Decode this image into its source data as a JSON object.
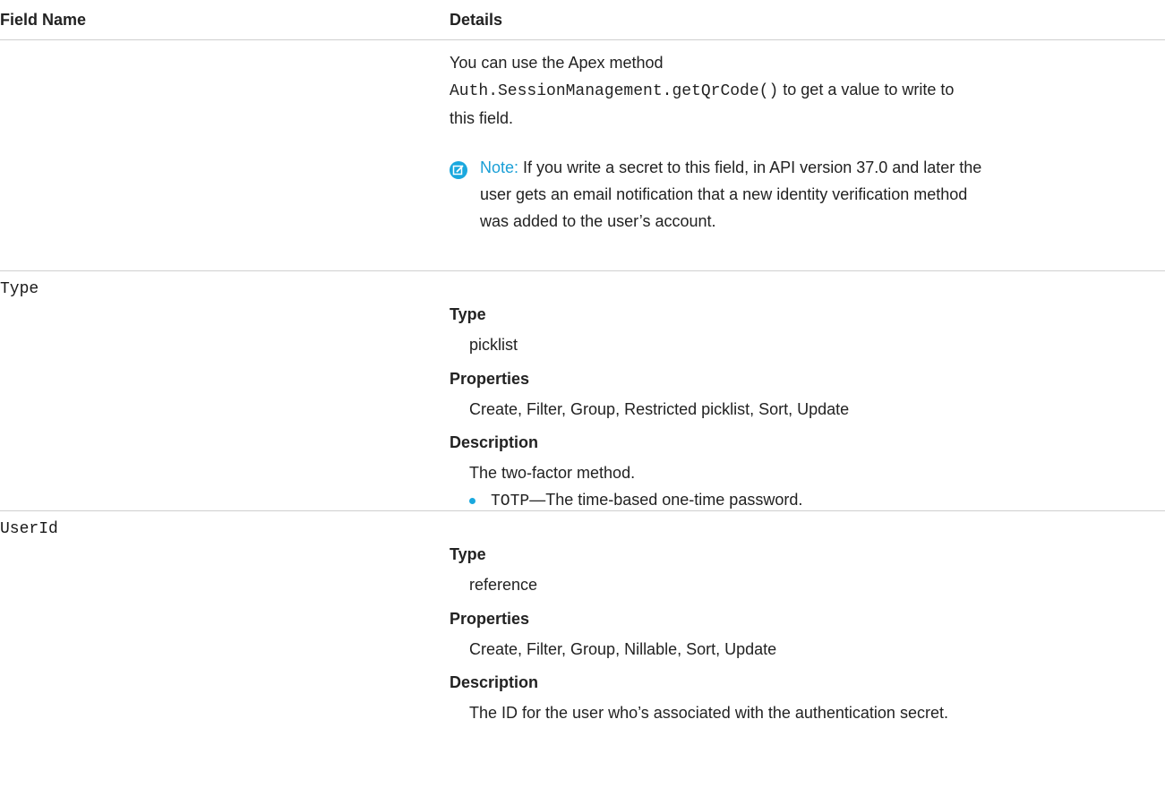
{
  "header": {
    "field_name": "Field Name",
    "details": "Details"
  },
  "intro": {
    "line1": "You can use the Apex method",
    "code": "Auth.SessionManagement.getQrCode()",
    "line2_suffix": "to get a value to write to",
    "line3": "this field."
  },
  "note": {
    "label": "Note:",
    "line1": "If you write a secret to this field, in API version 37.0 and later the",
    "line2": "user gets an email notification that a new identity verification method",
    "line3": "was added to the user’s account."
  },
  "fields": [
    {
      "name": "Type",
      "type_label": "Type",
      "type_value": "picklist",
      "properties_label": "Properties",
      "properties_value": "Create, Filter, Group, Restricted picklist, Sort, Update",
      "description_label": "Description",
      "description_value": "The two-factor method.",
      "bullet_code": "TOTP",
      "bullet_text": "—The time-based one-time password."
    },
    {
      "name": "UserId",
      "type_label": "Type",
      "type_value": "reference",
      "properties_label": "Properties",
      "properties_value": "Create, Filter, Group, Nillable, Sort, Update",
      "description_label": "Description",
      "description_value": "The ID for the user who’s associated with the authentication secret."
    }
  ],
  "colors": {
    "accent": "#1aa8de",
    "divider": "#cfcfcf"
  },
  "icons": {
    "note": "note-edit-icon",
    "bullet": "bullet-dot"
  }
}
